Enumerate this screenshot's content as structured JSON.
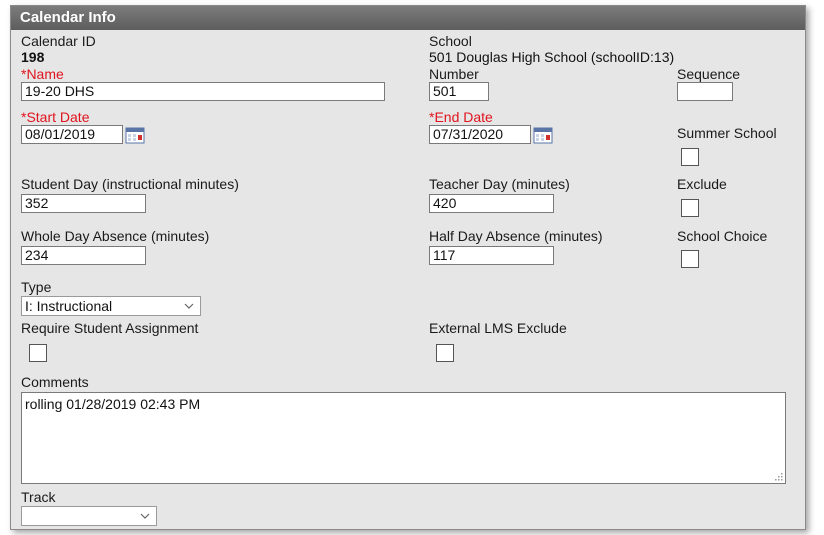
{
  "header": {
    "title": "Calendar Info"
  },
  "calendar_id": {
    "label": "Calendar ID",
    "value": "198"
  },
  "school": {
    "label": "School",
    "value": "501 Douglas High School (schoolID:13)"
  },
  "name": {
    "label": "*Name",
    "value": "19-20 DHS"
  },
  "number": {
    "label": "Number",
    "value": "501"
  },
  "sequence": {
    "label": "Sequence",
    "value": ""
  },
  "start_date": {
    "label": "*Start Date",
    "value": "08/01/2019"
  },
  "end_date": {
    "label": "*End Date",
    "value": "07/31/2020"
  },
  "summer_school": {
    "label": "Summer School",
    "checked": false
  },
  "student_day": {
    "label": "Student Day (instructional minutes)",
    "value": "352"
  },
  "teacher_day": {
    "label": "Teacher Day (minutes)",
    "value": "420"
  },
  "exclude": {
    "label": "Exclude",
    "checked": false
  },
  "whole_day_absence": {
    "label": "Whole Day Absence (minutes)",
    "value": "234"
  },
  "half_day_absence": {
    "label": "Half Day Absence (minutes)",
    "value": "117"
  },
  "school_choice": {
    "label": "School Choice",
    "checked": false
  },
  "type": {
    "label": "Type",
    "selected": "I: Instructional"
  },
  "require_student_assignment": {
    "label": "Require Student Assignment",
    "checked": false
  },
  "external_lms_exclude": {
    "label": "External LMS Exclude",
    "checked": false
  },
  "comments": {
    "label": "Comments",
    "value": "rolling 01/28/2019 02:43 PM"
  },
  "track": {
    "label": "Track",
    "selected": ""
  },
  "colors": {
    "required": "#e0141e",
    "header_bg": "#6e6e6e",
    "panel_bg": "#e6e6e6"
  }
}
